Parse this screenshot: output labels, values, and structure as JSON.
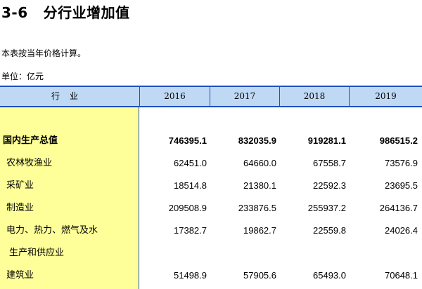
{
  "title": {
    "number": "3-6",
    "text": "分行业增加值"
  },
  "note": "本表按当年价格计算。",
  "unit": "单位：亿元",
  "table": {
    "headers": [
      "行业",
      "2016",
      "2017",
      "2018",
      "2019"
    ],
    "rows": [
      {
        "label": "国内生产总值",
        "values": [
          "746395.1",
          "832035.9",
          "919281.1",
          "986515.2"
        ],
        "bold": true
      },
      {
        "label": "农林牧渔业",
        "values": [
          "62451.0",
          "64660.0",
          "67558.7",
          "73576.9"
        ]
      },
      {
        "label": "采矿业",
        "values": [
          "18514.8",
          "21380.1",
          "22592.3",
          "23695.5"
        ]
      },
      {
        "label": "制造业",
        "values": [
          "209508.9",
          "233876.5",
          "255937.2",
          "264136.7"
        ]
      },
      {
        "label": "电力、热力、燃气及水",
        "values": [
          "17382.7",
          "19862.7",
          "22559.8",
          "24026.4"
        ]
      },
      {
        "label": "生产和供应业",
        "values": [
          "",
          "",
          "",
          ""
        ]
      },
      {
        "label": "建筑业",
        "values": [
          "51498.9",
          "57905.6",
          "65493.0",
          "70648.1"
        ]
      }
    ]
  }
}
